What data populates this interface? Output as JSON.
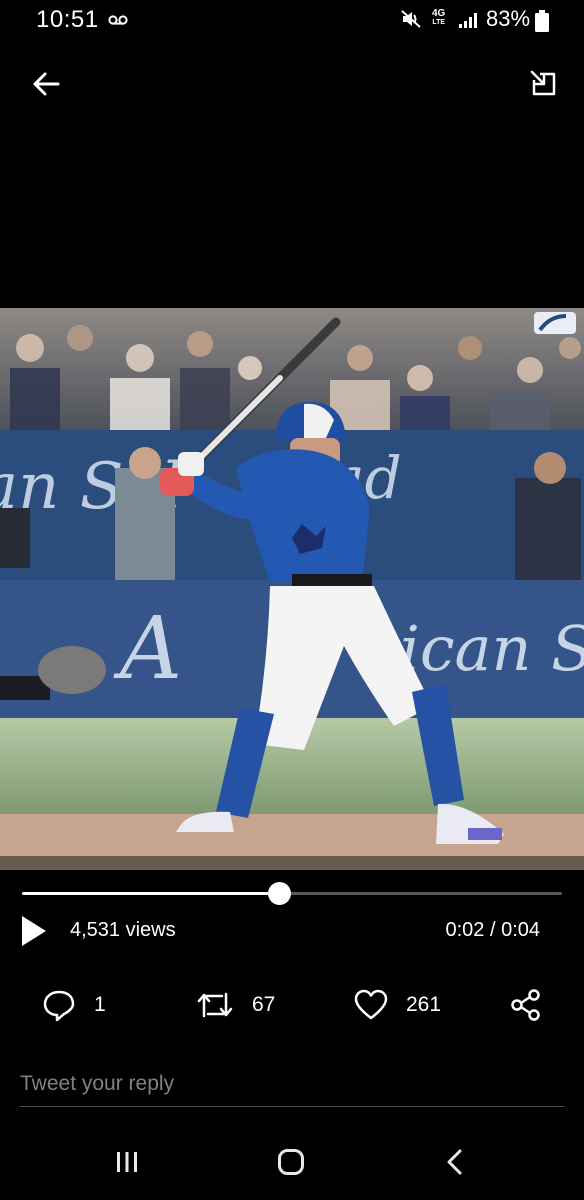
{
  "status_bar": {
    "time": "10:51",
    "network_type": "4G",
    "network_sub": "LTE",
    "battery_percent": "83%",
    "icons": [
      "voicemail-icon",
      "mute-icon",
      "signal-icon",
      "battery-icon"
    ]
  },
  "top_bar": {
    "icons": [
      "back-arrow-icon",
      "picture-in-picture-icon"
    ]
  },
  "video": {
    "progress_fraction": 0.475,
    "views": "4,531 views",
    "time_display": "0:02 / 0:04",
    "icons": [
      "play-icon",
      "mlb-logo-icon"
    ]
  },
  "actions": {
    "replies": "1",
    "retweets": "67",
    "likes": "261",
    "icons": [
      "reply-icon",
      "retweet-icon",
      "like-icon",
      "share-icon"
    ]
  },
  "reply_box": {
    "placeholder": "Tweet your reply"
  },
  "nav_bar": {
    "icons": [
      "recents-icon",
      "home-icon",
      "back-icon"
    ]
  },
  "colors": {
    "background": "#000000",
    "text": "#ffffff",
    "placeholder": "#7d8286",
    "track": "#55595d"
  }
}
